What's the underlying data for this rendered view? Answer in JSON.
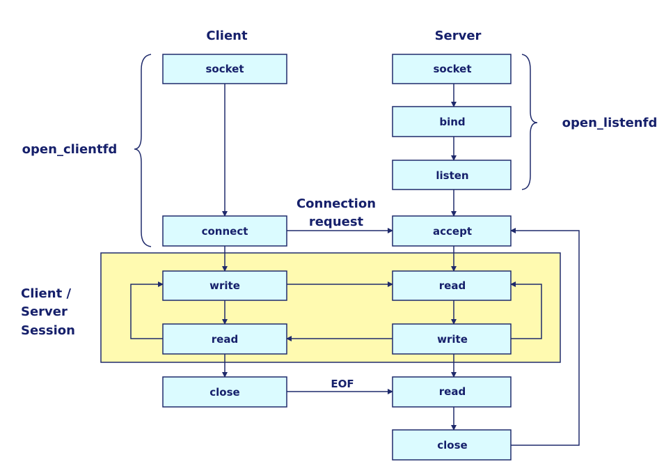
{
  "headers": {
    "client": "Client",
    "server": "Server"
  },
  "labels": {
    "open_clientfd": "open_clientfd",
    "open_listenfd": "open_listenfd",
    "connection_line1": "Connection",
    "connection_line2": "request",
    "session_line1": "Client /",
    "session_line2": "Server",
    "session_line3": "Session",
    "eof": "EOF"
  },
  "client_boxes": [
    "socket",
    "connect",
    "write",
    "read",
    "close"
  ],
  "server_boxes": [
    "socket",
    "bind",
    "listen",
    "accept",
    "read",
    "write",
    "read",
    "close"
  ],
  "colors": {
    "box_fill": "#dbfbff",
    "line": "#1f2a6b",
    "session_fill": "#fffab0",
    "text": "#16206b"
  }
}
